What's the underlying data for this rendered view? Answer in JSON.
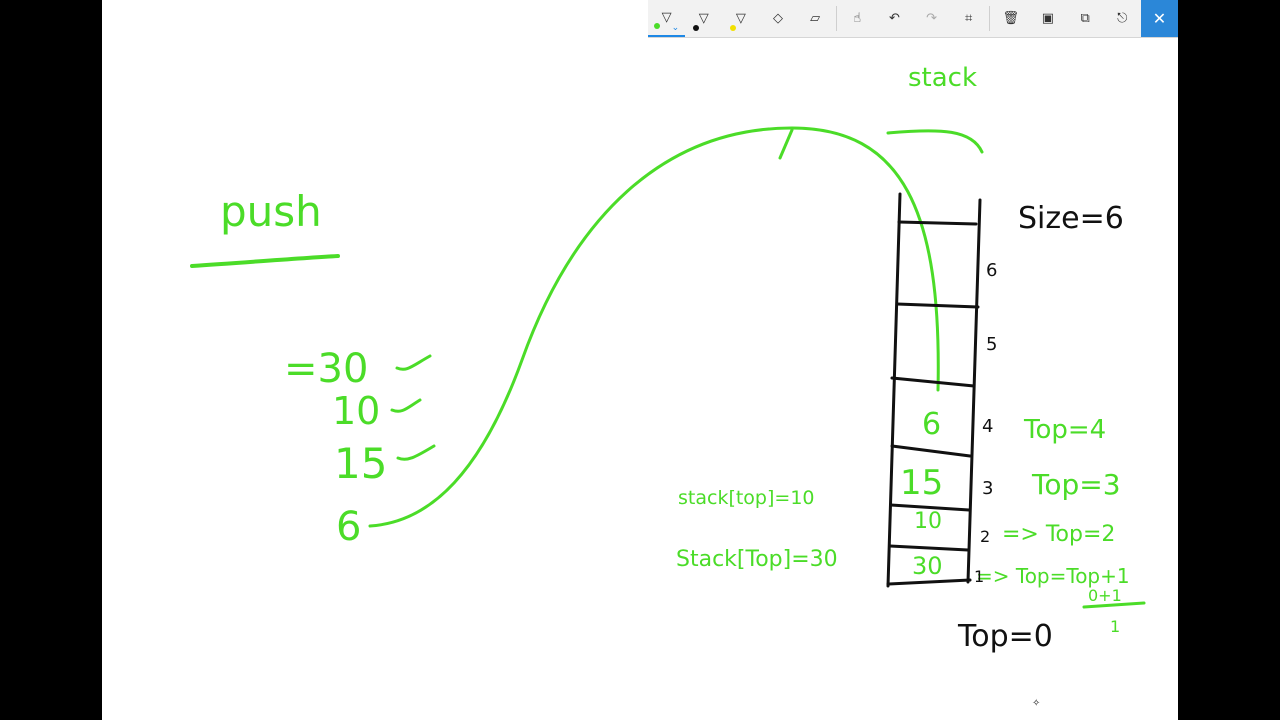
{
  "toolbar": {
    "pen_colors": {
      "pen1": "#4bdc28",
      "pen2": "#111111",
      "pen3": "#f2e000"
    },
    "close_icon": "✕"
  },
  "ink": {
    "title": "push",
    "stack_label": "stack",
    "size_label": "Size=6",
    "pushed_values": [
      "=30",
      "10",
      "15",
      "6"
    ],
    "cell_values": [
      "6",
      "15",
      "10",
      "30"
    ],
    "index_labels": [
      "6",
      "5",
      "4",
      "3",
      "2",
      "1"
    ],
    "top_labels": [
      "Top=4",
      "Top=3",
      "=> Top=2",
      "=> Top=Top+1"
    ],
    "formula_fraction": "0+1",
    "formula_result": "1",
    "stack_assign_1": "stack[top]=10",
    "stack_assign_2": "Stack[Top]=30",
    "top_zero": "Top=0"
  }
}
